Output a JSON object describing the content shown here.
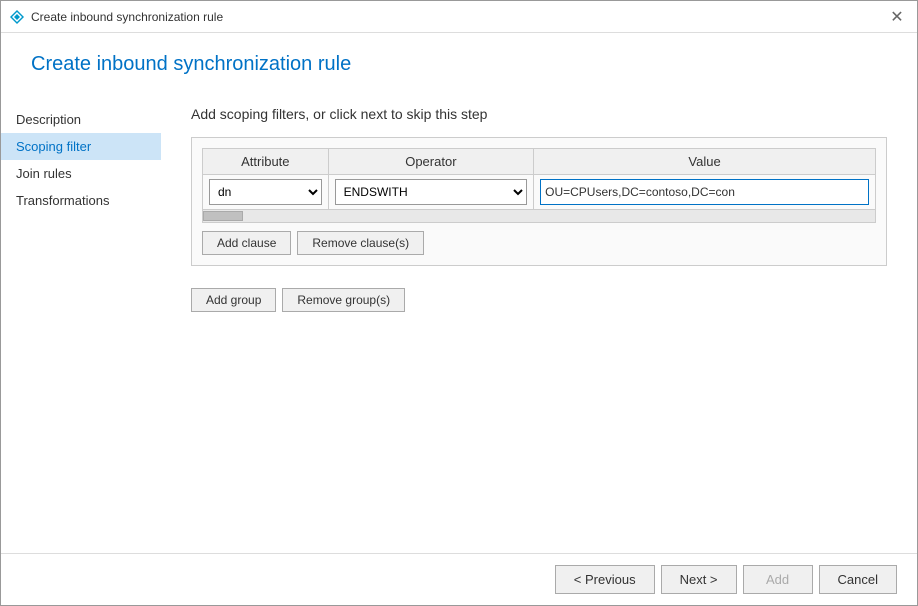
{
  "window": {
    "title": "Create inbound synchronization rule",
    "close_label": "✕"
  },
  "header": {
    "title": "Create inbound synchronization rule"
  },
  "sidebar": {
    "items": [
      {
        "label": "Description",
        "active": false
      },
      {
        "label": "Scoping filter",
        "active": true
      },
      {
        "label": "Join rules",
        "active": false
      },
      {
        "label": "Transformations",
        "active": false
      }
    ]
  },
  "main": {
    "step_title": "Add scoping filters, or click next to skip this step",
    "table": {
      "columns": [
        "Attribute",
        "Operator",
        "Value"
      ],
      "row": {
        "attribute_value": "dn",
        "operator_value": "ENDSWITH",
        "value_text": "OU=CPUsers,DC=contoso,DC=con"
      }
    },
    "buttons": {
      "add_clause": "Add clause",
      "remove_clause": "Remove clause(s)",
      "add_group": "Add group",
      "remove_group": "Remove group(s)"
    }
  },
  "footer": {
    "previous": "< Previous",
    "next": "Next >",
    "add": "Add",
    "cancel": "Cancel"
  },
  "icon": {
    "diamond_color": "#0099cc"
  }
}
